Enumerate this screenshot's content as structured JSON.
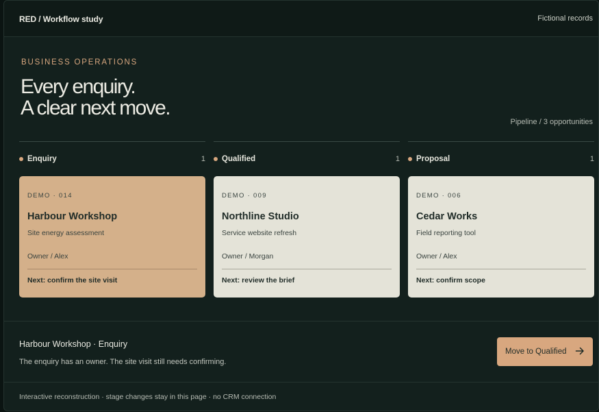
{
  "topbar": {
    "brand": "RED / Workflow study",
    "records": "Fictional records"
  },
  "hero": {
    "eyebrow": "BUSINESS OPERATIONS",
    "headline_line1": "Every enquiry.",
    "headline_line2": "A clear next move.",
    "pipeline": "Pipeline / 3 opportunities"
  },
  "columns": [
    {
      "title": "Enquiry",
      "count": "1",
      "card": {
        "id": "DEMO · 014",
        "title": "Harbour Workshop",
        "subtitle": "Site energy assessment",
        "owner": "Owner / Alex",
        "next": "Next: confirm the site visit",
        "selected": true
      }
    },
    {
      "title": "Qualified",
      "count": "1",
      "card": {
        "id": "DEMO · 009",
        "title": "Northline Studio",
        "subtitle": "Service website refresh",
        "owner": "Owner / Morgan",
        "next": "Next: review the brief",
        "selected": false
      }
    },
    {
      "title": "Proposal",
      "count": "1",
      "card": {
        "id": "DEMO · 006",
        "title": "Cedar Works",
        "subtitle": "Field reporting tool",
        "owner": "Owner / Alex",
        "next": "Next: confirm scope",
        "selected": false
      }
    }
  ],
  "detail": {
    "title": "Harbour Workshop · Enquiry",
    "text": "The enquiry has an owner. The site visit still needs confirming.",
    "action_label": "Move to Qualified",
    "action_icon": "arrow-right-icon"
  },
  "footer": {
    "text": "Interactive reconstruction · stage changes stay in this page · no CRM connection"
  },
  "colors": {
    "accent": "#d8a77f",
    "background": "#13201d",
    "card": "#e4e3d8",
    "card_selected": "#d4b08a"
  }
}
